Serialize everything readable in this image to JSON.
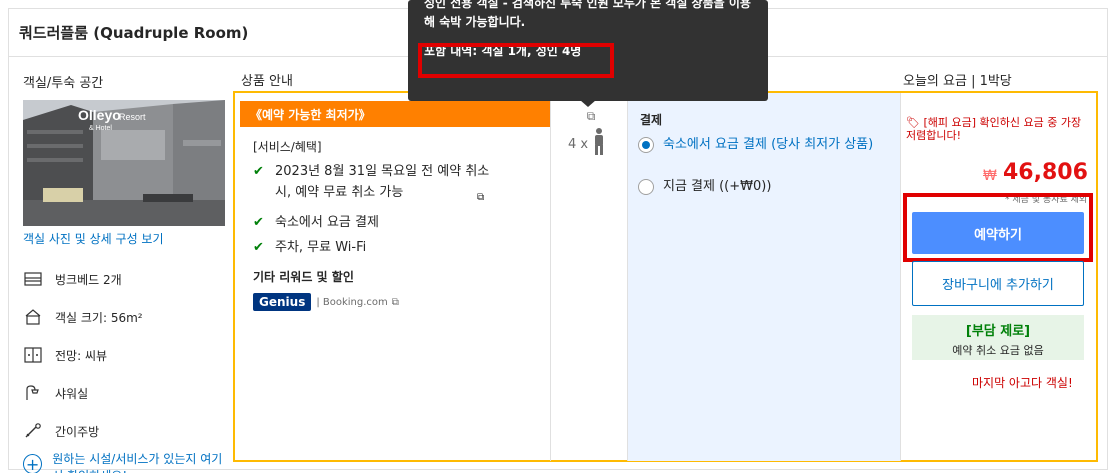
{
  "room": {
    "title": "쿼드러플룸 (Quadruple Room)",
    "photo_sign": "Olleyo",
    "photo_sign2": "Resort",
    "photo_sign3": "& Hotel",
    "photo_link": "객실 사진 및 상세 구성 보기",
    "facilities": [
      {
        "icon": "bed-icon",
        "label": "벙크베드 2개"
      },
      {
        "icon": "room-size-icon",
        "label": "객실 크기: 56m²"
      },
      {
        "icon": "view-icon",
        "label": "전망: 씨뷰"
      },
      {
        "icon": "shower-icon",
        "label": "샤워실"
      },
      {
        "icon": "kitchenette-icon",
        "label": "간이주방"
      }
    ],
    "ask_link": "원하는 시설/서비스가 있는지 여기서 확인하세요!"
  },
  "headers": {
    "room_type": "객실/투숙 공간",
    "product_info": "상품 안내",
    "today_price": "오늘의 요금 | 1박당"
  },
  "deal": {
    "tag": "《예약 가능한 최저가》",
    "conditions_head": "[서비스/혜택]",
    "conditions": [
      "2023년 8월 31일 목요일 전 예약 취소 시, 예약 무료 취소 가능",
      "숙소에서 요금 결제",
      "주차, 무료 Wi-Fi"
    ],
    "rewards_head": "기타 리워드 및 할인",
    "genius_badge": "Genius",
    "genius_by": "| Booking.com"
  },
  "occupancy": {
    "count": "4 x"
  },
  "payment": {
    "head": "결제",
    "options": [
      {
        "label": "숙소에서 요금 결제 (당사 최저가 상품)",
        "selected": true
      },
      {
        "label": "지금 결제 ((+₩0))",
        "selected": false
      }
    ]
  },
  "price": {
    "happy": "[해피 요금] 확인하신 요금 중 가장 저렴합니다!",
    "original": "₩",
    "current": "46,806",
    "tax": "* 세금 및 봉사료 제외",
    "book_button": "예약하기",
    "cart_button": "장바구니에 추가하기",
    "zero_title": "[부담 제로]",
    "zero_sub": "예약 취소 요금 없음",
    "last_room": "마지막 아고다 객실!"
  },
  "tooltip": {
    "line1": "성인 전용 객실 - 검색하신 투숙 인원 모두가 본 객실 상품을 이용해 숙박 가능합니다.",
    "line2": "포함 내역: 객실 1개, 성인 4명"
  }
}
